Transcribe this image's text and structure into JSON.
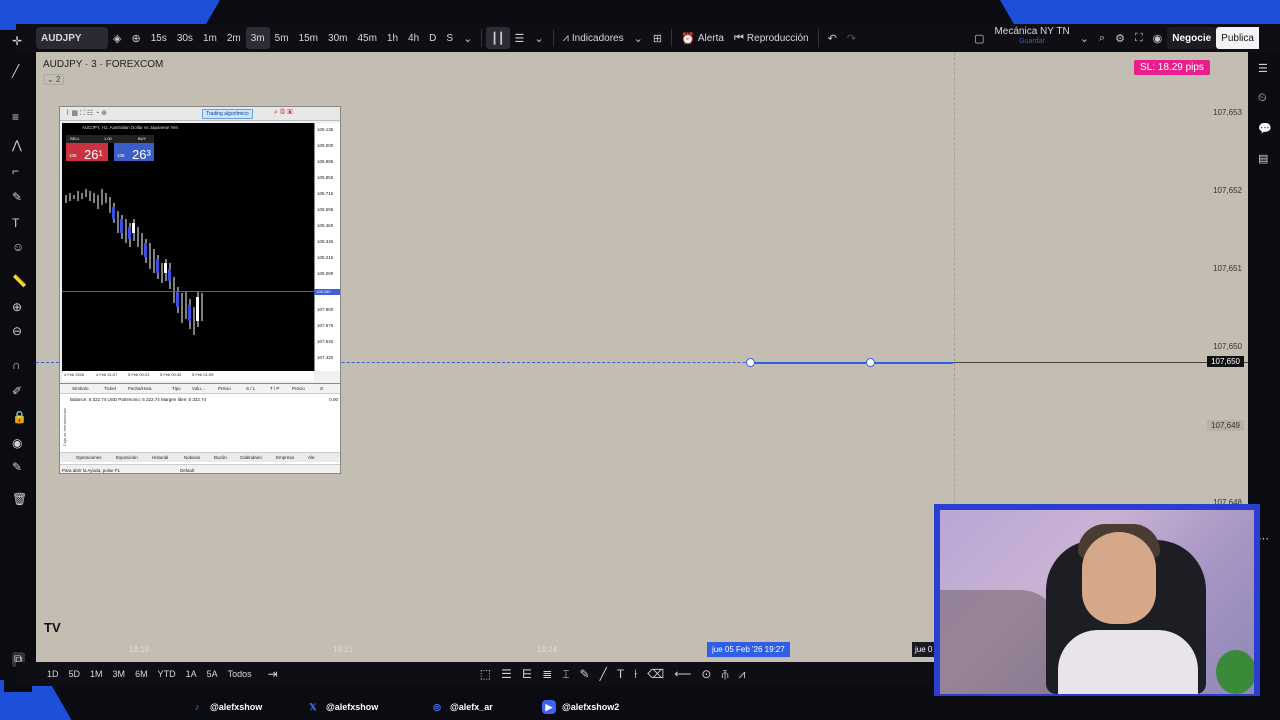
{
  "toolbar": {
    "symbol": "AUDJPY",
    "timeframes": [
      "15s",
      "30s",
      "1m",
      "2m",
      "3m",
      "5m",
      "15m",
      "30m",
      "45m",
      "1h",
      "4h",
      "D",
      "S"
    ],
    "active_timeframe": "3m",
    "indicators_label": "Indicadores",
    "alert_label": "Alerta",
    "replay_label": "Reproducción",
    "layout_name": "Mecánica NY TN",
    "layout_sub": "Guardar",
    "trade_label": "Negocie",
    "publish_label": "Publica"
  },
  "chart": {
    "title": "AUDJPY · 3 · FOREXCOM",
    "collapse_count": "2",
    "sl_badge": "SL: 18.29 pips",
    "prices": [
      "107,653",
      "107,652",
      "107,651",
      "107,650",
      "107,649",
      "107,648"
    ],
    "current_price": "107,650",
    "grey_price": "107,649",
    "line_color": "#2f5fe8",
    "bg_color": "#c4bdb1",
    "time_labels": [
      "19:18",
      "19:21",
      "19:24"
    ],
    "time_cursor": "jue 05 Feb '26   19:27",
    "time_cursor2": "jue 0"
  },
  "bottombar": {
    "ranges": [
      "1D",
      "5D",
      "1M",
      "3M",
      "6M",
      "YTD",
      "1A",
      "5A",
      "Todos"
    ]
  },
  "mt": {
    "algo_button": "Trading algorítmico",
    "chart_title": "AUDJPY, H1:  Australian Dollar vs Japanese Yen",
    "sell_label": "SELL",
    "buy_label": "BUY",
    "lot": "1.00",
    "sell_price_small": "108",
    "sell_price_big": "26¹",
    "buy_price_small": "108",
    "buy_price_big": "26³",
    "price_axis": [
      "109.135",
      "109.000",
      "108.985",
      "108.850",
      "108.715",
      "108.595",
      "108.460",
      "108.345",
      "108.215",
      "108.090",
      "107.935",
      "107.800",
      "107.675",
      "107.540",
      "107.420"
    ],
    "current_price": "108.260",
    "time_axis": [
      "4 Feb 2026",
      "4 Feb 21:07",
      "5 Feb 00:23",
      "5 Feb 00:45",
      "5 Feb 01:09"
    ],
    "terminal_headers": [
      "Símbolo",
      "Ticket",
      "Fecha/Hora",
      "Tipo",
      "Volu…",
      "Precio",
      "S / L",
      "T / P",
      "Precio",
      "S"
    ],
    "balance_line": "Balance: 5 322.74 USD  Patrimonio: 5 322.74  Margen libre: 5 322.74",
    "balance_value": "0.00",
    "side_label": "Caja de herramientas",
    "tabs": [
      "Operaciones",
      "Exposición",
      "Historial",
      "Noticias",
      "Buzón",
      "Calendario",
      "Empresa",
      "Ale"
    ],
    "status_left": "Para abrir la Ayuda, pulse F1",
    "status_right": "Default"
  },
  "socials": {
    "tiktok": "@alefxshow",
    "twitter": "@alefxshow",
    "instagram": "@alefx_ar",
    "youtube": "@alefxshow2"
  },
  "colors": {
    "accent": "#1d4fd8",
    "sl_badge": "#e91e8c",
    "sell": "#c8333f",
    "buy": "#3a5fc8"
  }
}
